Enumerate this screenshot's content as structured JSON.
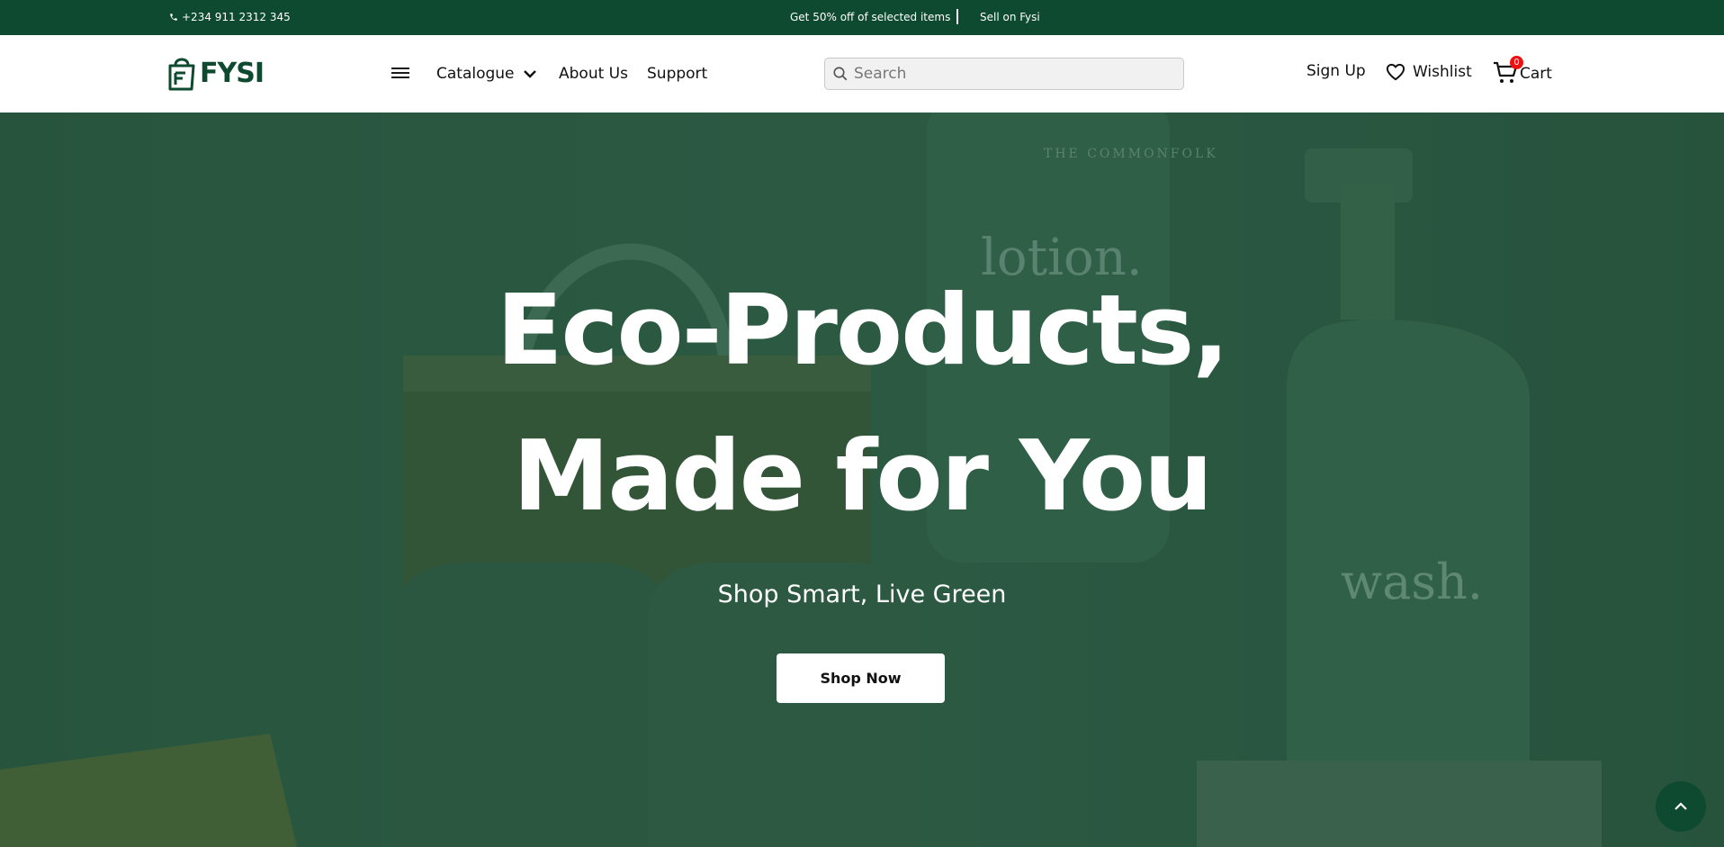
{
  "topbar": {
    "phone": "+234 911 2312 345",
    "promo": "Get 50% off of selected items",
    "sell": "Sell on Fysi"
  },
  "header": {
    "logo_text": "FYSI",
    "nav": {
      "catalogue": "Catalogue",
      "about": "About Us",
      "support": "Support"
    },
    "search": {
      "placeholder": "Search"
    },
    "signup": "Sign Up",
    "wishlist": "Wishlist",
    "cart": "Cart",
    "cart_count": "0"
  },
  "hero": {
    "title_line1": "Eco-Products,",
    "title_line2": "Made for You",
    "subtitle": "Shop Smart, Live Green",
    "cta": "Shop Now",
    "product_labels": {
      "brand": "THE COMMONFOLK",
      "lotion": "lotion.",
      "wash": "wash."
    }
  },
  "colors": {
    "brand_green": "#0d4a30",
    "hero_overlay": "#2f5e47",
    "badge_red": "#e11111"
  },
  "icons": [
    "phone-icon",
    "logo-bag-icon",
    "menu-icon",
    "chevron-down-icon",
    "search-icon",
    "heart-icon",
    "cart-icon",
    "chevron-up-icon"
  ]
}
